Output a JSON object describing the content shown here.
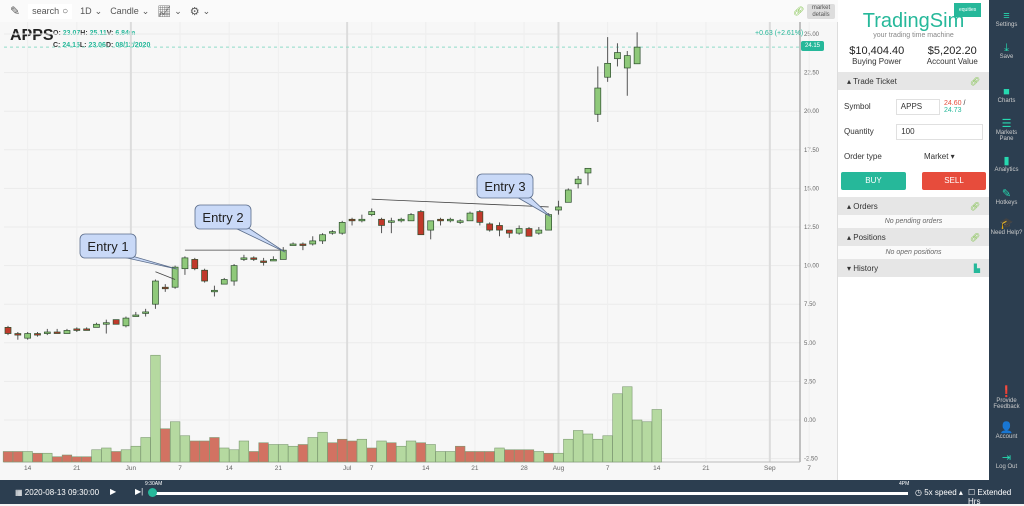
{
  "toolbar": {
    "search_label": "search",
    "interval": "1D",
    "chart_type": "Candle",
    "market_details": "market details"
  },
  "symbol": "APPS",
  "ohlc": {
    "o_label": "O:",
    "o": "23.07",
    "h_label": "H:",
    "h": "25.11",
    "v_label": "V:",
    "v": "6.84m",
    "c_label": "C:",
    "c": "24.15",
    "l_label": "L:",
    "l": "23.06",
    "d_label": "D:",
    "d": "08/12/2020"
  },
  "change": "+0.63 (+2.61%)",
  "last_price": "24.15",
  "chart_data": {
    "type": "candlestick",
    "title": "APPS",
    "ylim": [
      -2.5,
      25
    ],
    "yticks": [
      "25.00",
      "22.50",
      "20.00",
      "17.50",
      "15.00",
      "12.50",
      "10.00",
      "7.50",
      "5.00",
      "2.50",
      "0.00",
      "-2.50"
    ],
    "xticks": [
      {
        "label": "14",
        "i": 2
      },
      {
        "label": "21",
        "i": 7
      },
      {
        "label": "Jun",
        "i": 12.5
      },
      {
        "label": "7",
        "i": 17.5
      },
      {
        "label": "14",
        "i": 22.5
      },
      {
        "label": "21",
        "i": 27.5
      },
      {
        "label": "Jul",
        "i": 34.5
      },
      {
        "label": "7",
        "i": 37
      },
      {
        "label": "14",
        "i": 42.5
      },
      {
        "label": "21",
        "i": 47.5
      },
      {
        "label": "28",
        "i": 52.5
      },
      {
        "label": "Aug",
        "i": 56
      },
      {
        "label": "7",
        "i": 61
      },
      {
        "label": "14",
        "i": 66
      },
      {
        "label": "21",
        "i": 71
      },
      {
        "label": "Sep",
        "i": 77.5
      },
      {
        "label": "7",
        "i": 81.5
      }
    ],
    "candles": [
      [
        6.0,
        5.6,
        6.1,
        5.5
      ],
      [
        5.6,
        5.5,
        5.7,
        5.2
      ],
      [
        5.3,
        5.6,
        5.7,
        5.2
      ],
      [
        5.6,
        5.5,
        5.7,
        5.4
      ],
      [
        5.6,
        5.7,
        5.9,
        5.5
      ],
      [
        5.7,
        5.6,
        5.9,
        5.6
      ],
      [
        5.6,
        5.8,
        5.9,
        5.6
      ],
      [
        5.9,
        5.8,
        6.0,
        5.7
      ],
      [
        5.9,
        5.8,
        6.0,
        5.8
      ],
      [
        6.0,
        6.2,
        6.3,
        6.0
      ],
      [
        6.3,
        6.3,
        6.5,
        5.6
      ],
      [
        6.5,
        6.2,
        6.5,
        6.2
      ],
      [
        6.1,
        6.6,
        6.7,
        6.0
      ],
      [
        6.8,
        6.8,
        7.0,
        6.7
      ],
      [
        7.0,
        7.0,
        7.2,
        6.7
      ],
      [
        7.5,
        9.0,
        9.1,
        7.2
      ],
      [
        8.6,
        8.5,
        8.8,
        8.3
      ],
      [
        8.6,
        9.9,
        10.0,
        8.5
      ],
      [
        9.8,
        10.5,
        10.6,
        9.4
      ],
      [
        10.4,
        9.8,
        10.5,
        9.7
      ],
      [
        9.7,
        9.0,
        9.8,
        8.9
      ],
      [
        8.4,
        8.4,
        8.7,
        8.0
      ],
      [
        8.8,
        9.1,
        9.2,
        8.8
      ],
      [
        9.0,
        10.0,
        10.1,
        8.7
      ],
      [
        10.4,
        10.5,
        10.7,
        10.3
      ],
      [
        10.5,
        10.4,
        10.6,
        10.3
      ],
      [
        10.3,
        10.2,
        10.5,
        10.0
      ],
      [
        10.4,
        10.4,
        10.6,
        10.3
      ],
      [
        10.4,
        11.0,
        11.2,
        10.4
      ],
      [
        11.3,
        11.4,
        11.5,
        11.3
      ],
      [
        11.4,
        11.3,
        11.5,
        11.0
      ],
      [
        11.4,
        11.6,
        11.9,
        11.3
      ],
      [
        11.6,
        12.0,
        12.1,
        11.4
      ],
      [
        12.1,
        12.2,
        12.3,
        12.0
      ],
      [
        12.1,
        12.8,
        12.9,
        12.0
      ],
      [
        13.0,
        12.9,
        13.1,
        12.6
      ],
      [
        12.9,
        13.0,
        13.3,
        12.8
      ],
      [
        13.3,
        13.5,
        13.7,
        13.2
      ],
      [
        13.0,
        12.6,
        13.1,
        12.1
      ],
      [
        12.9,
        12.9,
        13.1,
        12.1
      ],
      [
        12.9,
        13.0,
        13.1,
        12.8
      ],
      [
        12.9,
        13.3,
        13.4,
        12.9
      ],
      [
        13.5,
        12.0,
        13.6,
        12.0
      ],
      [
        12.3,
        12.9,
        12.9,
        11.7
      ],
      [
        13.0,
        12.9,
        13.1,
        12.6
      ],
      [
        12.9,
        13.0,
        13.1,
        12.8
      ],
      [
        12.8,
        12.9,
        13.0,
        12.7
      ],
      [
        12.9,
        13.4,
        13.5,
        12.9
      ],
      [
        13.5,
        12.8,
        13.6,
        12.6
      ],
      [
        12.7,
        12.3,
        12.8,
        12.2
      ],
      [
        12.6,
        12.3,
        12.8,
        11.9
      ],
      [
        12.3,
        12.1,
        12.3,
        11.8
      ],
      [
        12.1,
        12.4,
        12.6,
        12.0
      ],
      [
        12.4,
        11.9,
        12.5,
        11.9
      ],
      [
        12.1,
        12.3,
        12.5,
        12.0
      ],
      [
        12.3,
        13.3,
        13.4,
        12.3
      ],
      [
        13.6,
        13.8,
        14.2,
        13.3
      ],
      [
        14.1,
        14.9,
        15.0,
        14.1
      ],
      [
        15.3,
        15.6,
        15.8,
        15.0
      ],
      [
        16.0,
        16.3,
        16.3,
        15.2
      ],
      [
        19.8,
        21.5,
        22.9,
        19.3
      ],
      [
        22.2,
        23.1,
        24.8,
        21.9
      ],
      [
        23.4,
        23.8,
        24.4,
        22.9
      ],
      [
        22.8,
        23.6,
        23.9,
        21.0
      ],
      [
        23.07,
        24.15,
        25.11,
        23.06
      ]
    ],
    "volumes": [
      [
        0.6,
        "d"
      ],
      [
        0.6,
        "d"
      ],
      [
        0.6,
        "u"
      ],
      [
        0.5,
        "d"
      ],
      [
        0.5,
        "u"
      ],
      [
        0.3,
        "d"
      ],
      [
        0.4,
        "d"
      ],
      [
        0.3,
        "d"
      ],
      [
        0.3,
        "d"
      ],
      [
        0.7,
        "u"
      ],
      [
        0.8,
        "u"
      ],
      [
        0.6,
        "d"
      ],
      [
        0.7,
        "u"
      ],
      [
        0.9,
        "u"
      ],
      [
        1.4,
        "u"
      ],
      [
        6.1,
        "u"
      ],
      [
        1.9,
        "d"
      ],
      [
        2.3,
        "u"
      ],
      [
        1.5,
        "u"
      ],
      [
        1.2,
        "d"
      ],
      [
        1.2,
        "d"
      ],
      [
        1.4,
        "d"
      ],
      [
        0.8,
        "u"
      ],
      [
        0.7,
        "u"
      ],
      [
        1.2,
        "u"
      ],
      [
        0.6,
        "d"
      ],
      [
        1.1,
        "d"
      ],
      [
        1.0,
        "u"
      ],
      [
        1.0,
        "u"
      ],
      [
        0.9,
        "u"
      ],
      [
        1.0,
        "d"
      ],
      [
        1.4,
        "u"
      ],
      [
        1.7,
        "u"
      ],
      [
        1.1,
        "d"
      ],
      [
        1.3,
        "d"
      ],
      [
        1.2,
        "d"
      ],
      [
        1.3,
        "u"
      ],
      [
        0.8,
        "d"
      ],
      [
        1.2,
        "u"
      ],
      [
        1.1,
        "d"
      ],
      [
        0.9,
        "u"
      ],
      [
        1.2,
        "u"
      ],
      [
        1.1,
        "d"
      ],
      [
        1.0,
        "u"
      ],
      [
        0.6,
        "u"
      ],
      [
        0.6,
        "u"
      ],
      [
        0.9,
        "d"
      ],
      [
        0.6,
        "d"
      ],
      [
        0.6,
        "d"
      ],
      [
        0.6,
        "d"
      ],
      [
        0.8,
        "u"
      ],
      [
        0.7,
        "d"
      ],
      [
        0.7,
        "d"
      ],
      [
        0.7,
        "d"
      ],
      [
        0.6,
        "u"
      ],
      [
        0.5,
        "d"
      ],
      [
        0.5,
        "u"
      ],
      [
        1.3,
        "u"
      ],
      [
        1.8,
        "u"
      ],
      [
        1.6,
        "u"
      ],
      [
        1.3,
        "u"
      ],
      [
        1.5,
        "u"
      ],
      [
        3.9,
        "u"
      ],
      [
        4.3,
        "u"
      ],
      [
        2.4,
        "u"
      ],
      [
        2.3,
        "u"
      ],
      [
        3.0,
        "u"
      ]
    ],
    "annotations": [
      {
        "text": "Entry 1",
        "i": 17
      },
      {
        "text": "Entry 2",
        "i": 28
      },
      {
        "text": "Entry 3",
        "i": 55
      }
    ],
    "trendlines": [
      {
        "from": 18,
        "to": 28,
        "price": 10.5
      },
      {
        "from": 37,
        "to": 55,
        "price": 13.8,
        "price_end": 13.3
      },
      {
        "from": 15,
        "to": 17,
        "price": 9.1,
        "price_end": 8.6
      }
    ]
  },
  "sidebar": {
    "badge": "equities",
    "brand": "TradingSim",
    "tagline": "your trading time machine",
    "buying_power": "$10,404.40",
    "buying_power_label": "Buying Power",
    "account_value": "$5,202.20",
    "account_value_label": "Account Value",
    "trade_ticket": "Trade Ticket",
    "symbol_label": "Symbol",
    "symbol_value": "APPS",
    "bid": "24.60",
    "ask": "24.73",
    "quantity_label": "Quantity",
    "quantity_value": "100",
    "order_type_label": "Order type",
    "order_type_value": "Market",
    "buy": "BUY",
    "sell": "SELL",
    "orders": "Orders",
    "no_orders": "No pending orders",
    "positions": "Positions",
    "no_positions": "No open positions",
    "history": "History",
    "buy_color": "#26b89a",
    "sell_color": "#e74c3c"
  },
  "rail": [
    {
      "icon": "≡",
      "label": "Settings"
    },
    {
      "icon": "⤓",
      "label": "Save"
    },
    {
      "icon": "■",
      "label": "Charts"
    },
    {
      "icon": "☰",
      "label": "Markets Pane"
    },
    {
      "icon": "▮",
      "label": "Analytics"
    },
    {
      "icon": "✎",
      "label": "Hotkeys"
    },
    {
      "icon": "🎓",
      "label": "Need Help?"
    },
    {
      "icon": "❗",
      "label": "Provide Feedback"
    },
    {
      "icon": "👤",
      "label": "Account"
    },
    {
      "icon": "⇥",
      "label": "Log Out"
    }
  ],
  "playback": {
    "datetime": "2020-08-13  09:30:00",
    "start": "9:30AM",
    "end": "4PM",
    "progress": 0,
    "speed": "5x speed",
    "extended": "Extended Hrs"
  }
}
